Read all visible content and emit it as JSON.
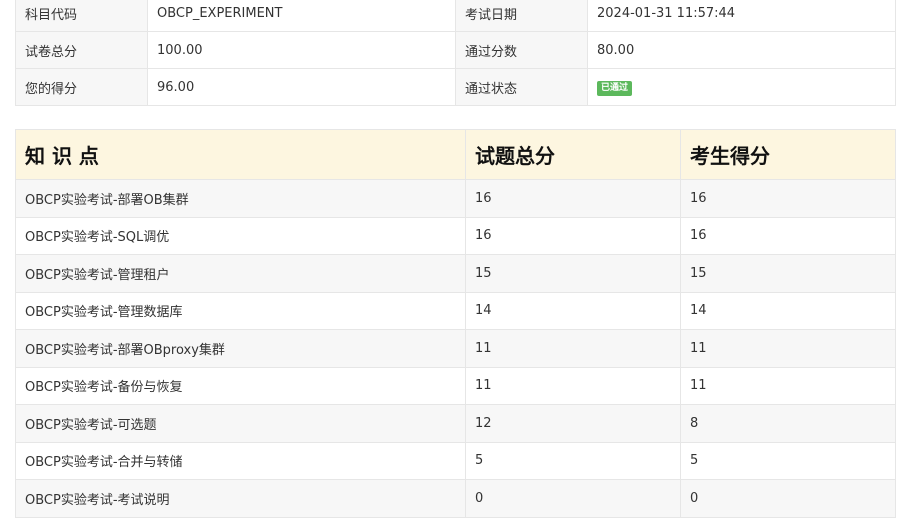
{
  "info": {
    "subject_code_label": "科目代码",
    "subject_code_value": "OBCP_EXPERIMENT",
    "exam_date_label": "考试日期",
    "exam_date_value": "2024-01-31 11:57:44",
    "total_score_label": "试卷总分",
    "total_score_value": "100.00",
    "pass_score_label": "通过分数",
    "pass_score_value": "80.00",
    "your_score_label": "您的得分",
    "your_score_value": "96.00",
    "pass_status_label": "通过状态",
    "pass_status_value": "已通过",
    "pass_status_color": "#5cb85c"
  },
  "knowledge": {
    "headers": {
      "topic": "知 识 点",
      "total": "试题总分",
      "score": "考生得分"
    },
    "header_bg": "#fdf6e0",
    "rows": [
      {
        "topic": "OBCP实验考试-部署OB集群",
        "total": "16",
        "score": "16"
      },
      {
        "topic": "OBCP实验考试-SQL调优",
        "total": "16",
        "score": "16"
      },
      {
        "topic": "OBCP实验考试-管理租户",
        "total": "15",
        "score": "15"
      },
      {
        "topic": "OBCP实验考试-管理数据库",
        "total": "14",
        "score": "14"
      },
      {
        "topic": "OBCP实验考试-部署OBproxy集群",
        "total": "11",
        "score": "11"
      },
      {
        "topic": "OBCP实验考试-备份与恢复",
        "total": "11",
        "score": "11"
      },
      {
        "topic": "OBCP实验考试-可选题",
        "total": "12",
        "score": "8"
      },
      {
        "topic": "OBCP实验考试-合并与转储",
        "total": "5",
        "score": "5"
      },
      {
        "topic": "OBCP实验考试-考试说明",
        "total": "0",
        "score": "0"
      }
    ]
  }
}
